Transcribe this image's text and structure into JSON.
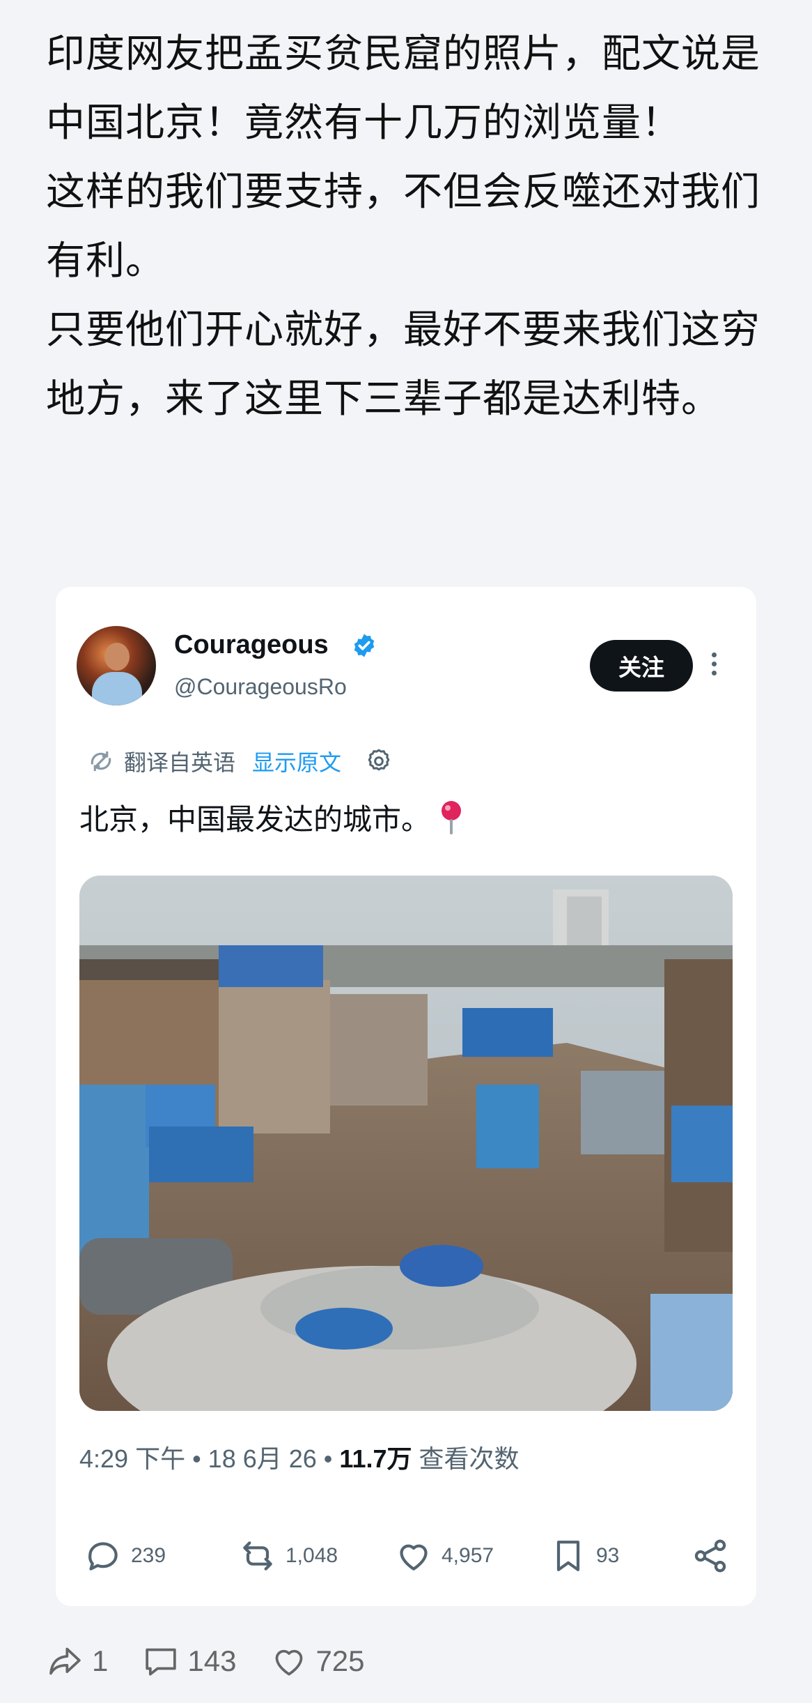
{
  "post": {
    "paragraphs": [
      "印度网友把孟买贫民窟的照片，配文说是中国北京！竟然有十几万的浏览量！",
      "这样的我们要支持，不但会反噬还对我们有利。",
      "只要他们开心就好，最好不要来我们这穷地方，来了这里下三辈子都是达利特。"
    ]
  },
  "tweet": {
    "display_name": "Courageous",
    "handle": "@CourageousRo",
    "follow_label": "关注",
    "translated_from": "翻译自英语",
    "show_original": "显示原文",
    "text": "北京，中国最发达的城市。",
    "meta": {
      "time": "4:29 下午 • 18 6月 26 • ",
      "views": "11.7万",
      "views_label": " 查看次数"
    },
    "actions": {
      "reply_count": "239",
      "retweet_count": "1,048",
      "like_count": "4,957",
      "bookmark_count": "93"
    },
    "icons": [
      "verified-badge-icon",
      "translate-icon",
      "gear-icon",
      "pin-icon",
      "reply-icon",
      "retweet-icon",
      "like-icon",
      "bookmark-icon",
      "share-icon"
    ],
    "colors": {
      "verified": "#1d9bf0",
      "link": "#1d9bf0",
      "follow_bg": "#0f1419"
    }
  },
  "footer": {
    "share_count": "1",
    "comment_count": "143",
    "like_count": "725"
  }
}
